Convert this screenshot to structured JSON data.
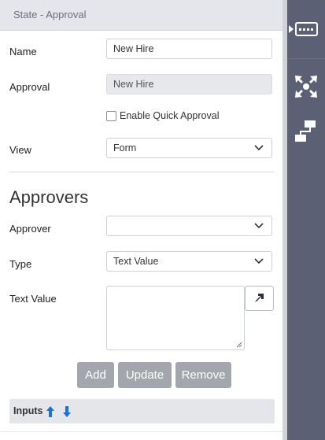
{
  "panel": {
    "title": "State - Approval"
  },
  "form": {
    "name_label": "Name",
    "name_value": "New Hire",
    "approval_label": "Approval",
    "approval_value": "New Hire",
    "quick_approval_label": "Enable Quick Approval",
    "quick_approval_checked": false,
    "view_label": "View",
    "view_value": "Form"
  },
  "approvers": {
    "section_title": "Approvers",
    "approver_label": "Approver",
    "approver_value": "",
    "type_label": "Type",
    "type_value": "Text Value",
    "text_value_label": "Text Value",
    "text_value": ""
  },
  "buttons": {
    "add": "Add",
    "update": "Update",
    "remove": "Remove"
  },
  "inputs": {
    "label": "Inputs"
  },
  "icons": {
    "rail_top": "form-settings-icon",
    "rail_middle": "move-arrows-icon",
    "rail_bottom": "connector-icon",
    "expand": "expand-arrow-icon",
    "sort_up": "arrow-up-icon",
    "sort_down": "arrow-down-icon"
  },
  "colors": {
    "rail": "#5b6075",
    "button": "#a3a6ac",
    "arrow": "#1f6fd1"
  }
}
